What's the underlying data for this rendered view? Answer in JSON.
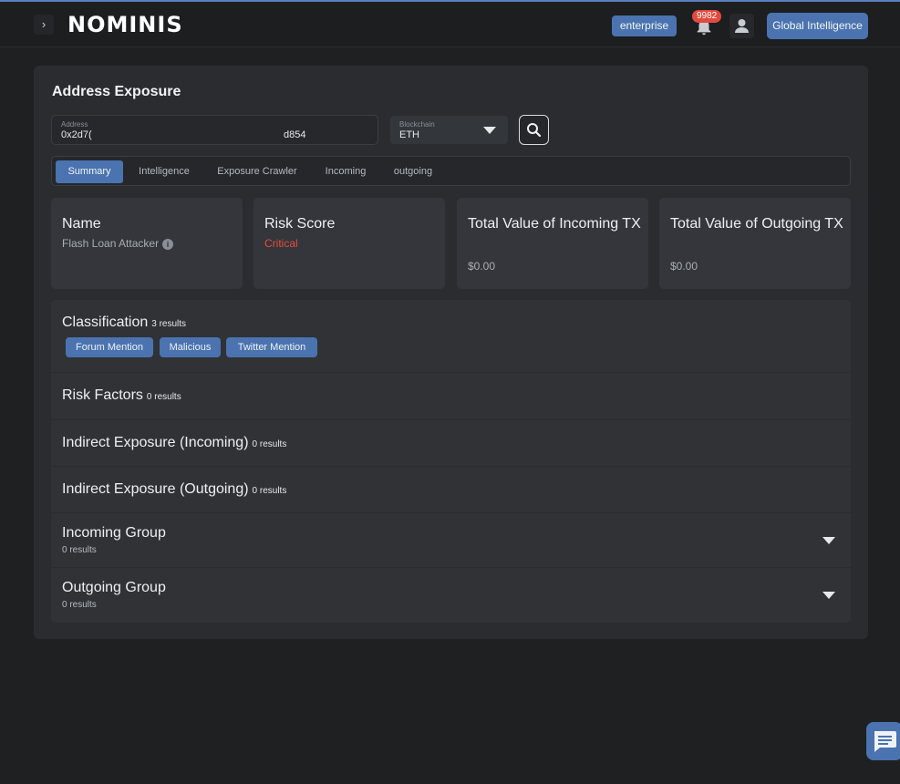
{
  "header": {
    "logo_text": "NOMINIS",
    "plan_badge": "enterprise",
    "notification_count": "9982",
    "global_button": "Global Intelligence"
  },
  "page": {
    "title": "Address Exposure",
    "address": {
      "label": "Address",
      "value_prefix": "0x2d7(",
      "value_suffix": "d854"
    },
    "blockchain": {
      "label": "Blockchain",
      "value": "ETH"
    },
    "tabs": [
      {
        "label": "Summary",
        "active": true
      },
      {
        "label": "Intelligence",
        "active": false
      },
      {
        "label": "Exposure Crawler",
        "active": false
      },
      {
        "label": "Incoming",
        "active": false
      },
      {
        "label": "outgoing",
        "active": false
      }
    ],
    "cards": [
      {
        "title": "Name",
        "value": "Flash Loan Attacker"
      },
      {
        "title": "Risk Score",
        "value": "Critical"
      },
      {
        "title": "Total Value of Incoming TX",
        "value": "$0.00"
      },
      {
        "title": "Total Value of Outgoing TX",
        "value": "$0.00"
      }
    ],
    "classification": {
      "title": "Classification",
      "count": "3 results",
      "tags": [
        "Forum Mention",
        "Malicious",
        "Twitter Mention"
      ]
    },
    "sections": [
      {
        "title": "Risk Factors",
        "count": "0 results"
      },
      {
        "title": "Indirect Exposure (Incoming)",
        "count": "0 results"
      },
      {
        "title": "Indirect Exposure (Outgoing)",
        "count": "0 results"
      }
    ],
    "groups": [
      {
        "title": "Incoming Group",
        "count": "0 results"
      },
      {
        "title": "Outgoing Group",
        "count": "0 results"
      }
    ]
  },
  "colors": {
    "accent": "#4a73b0",
    "critical": "#e64b3c",
    "background": "#1f2022",
    "panel": "#2a2c30"
  }
}
